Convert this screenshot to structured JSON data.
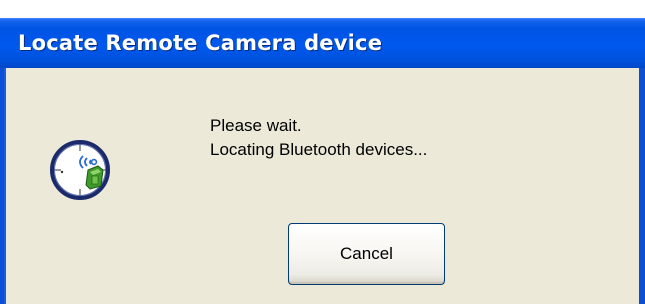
{
  "window": {
    "title": "Locate Remote Camera device"
  },
  "dialog": {
    "icon": "bluetooth-radar-icon",
    "message_line1": "Please wait.",
    "message_line2": "Locating Bluetooth devices..."
  },
  "buttons": {
    "cancel_label": "Cancel"
  },
  "colors": {
    "titlebar": "#0054e3",
    "client_background": "#ece9d8",
    "frame": "#0a4fd6",
    "button_border": "#003c74"
  }
}
